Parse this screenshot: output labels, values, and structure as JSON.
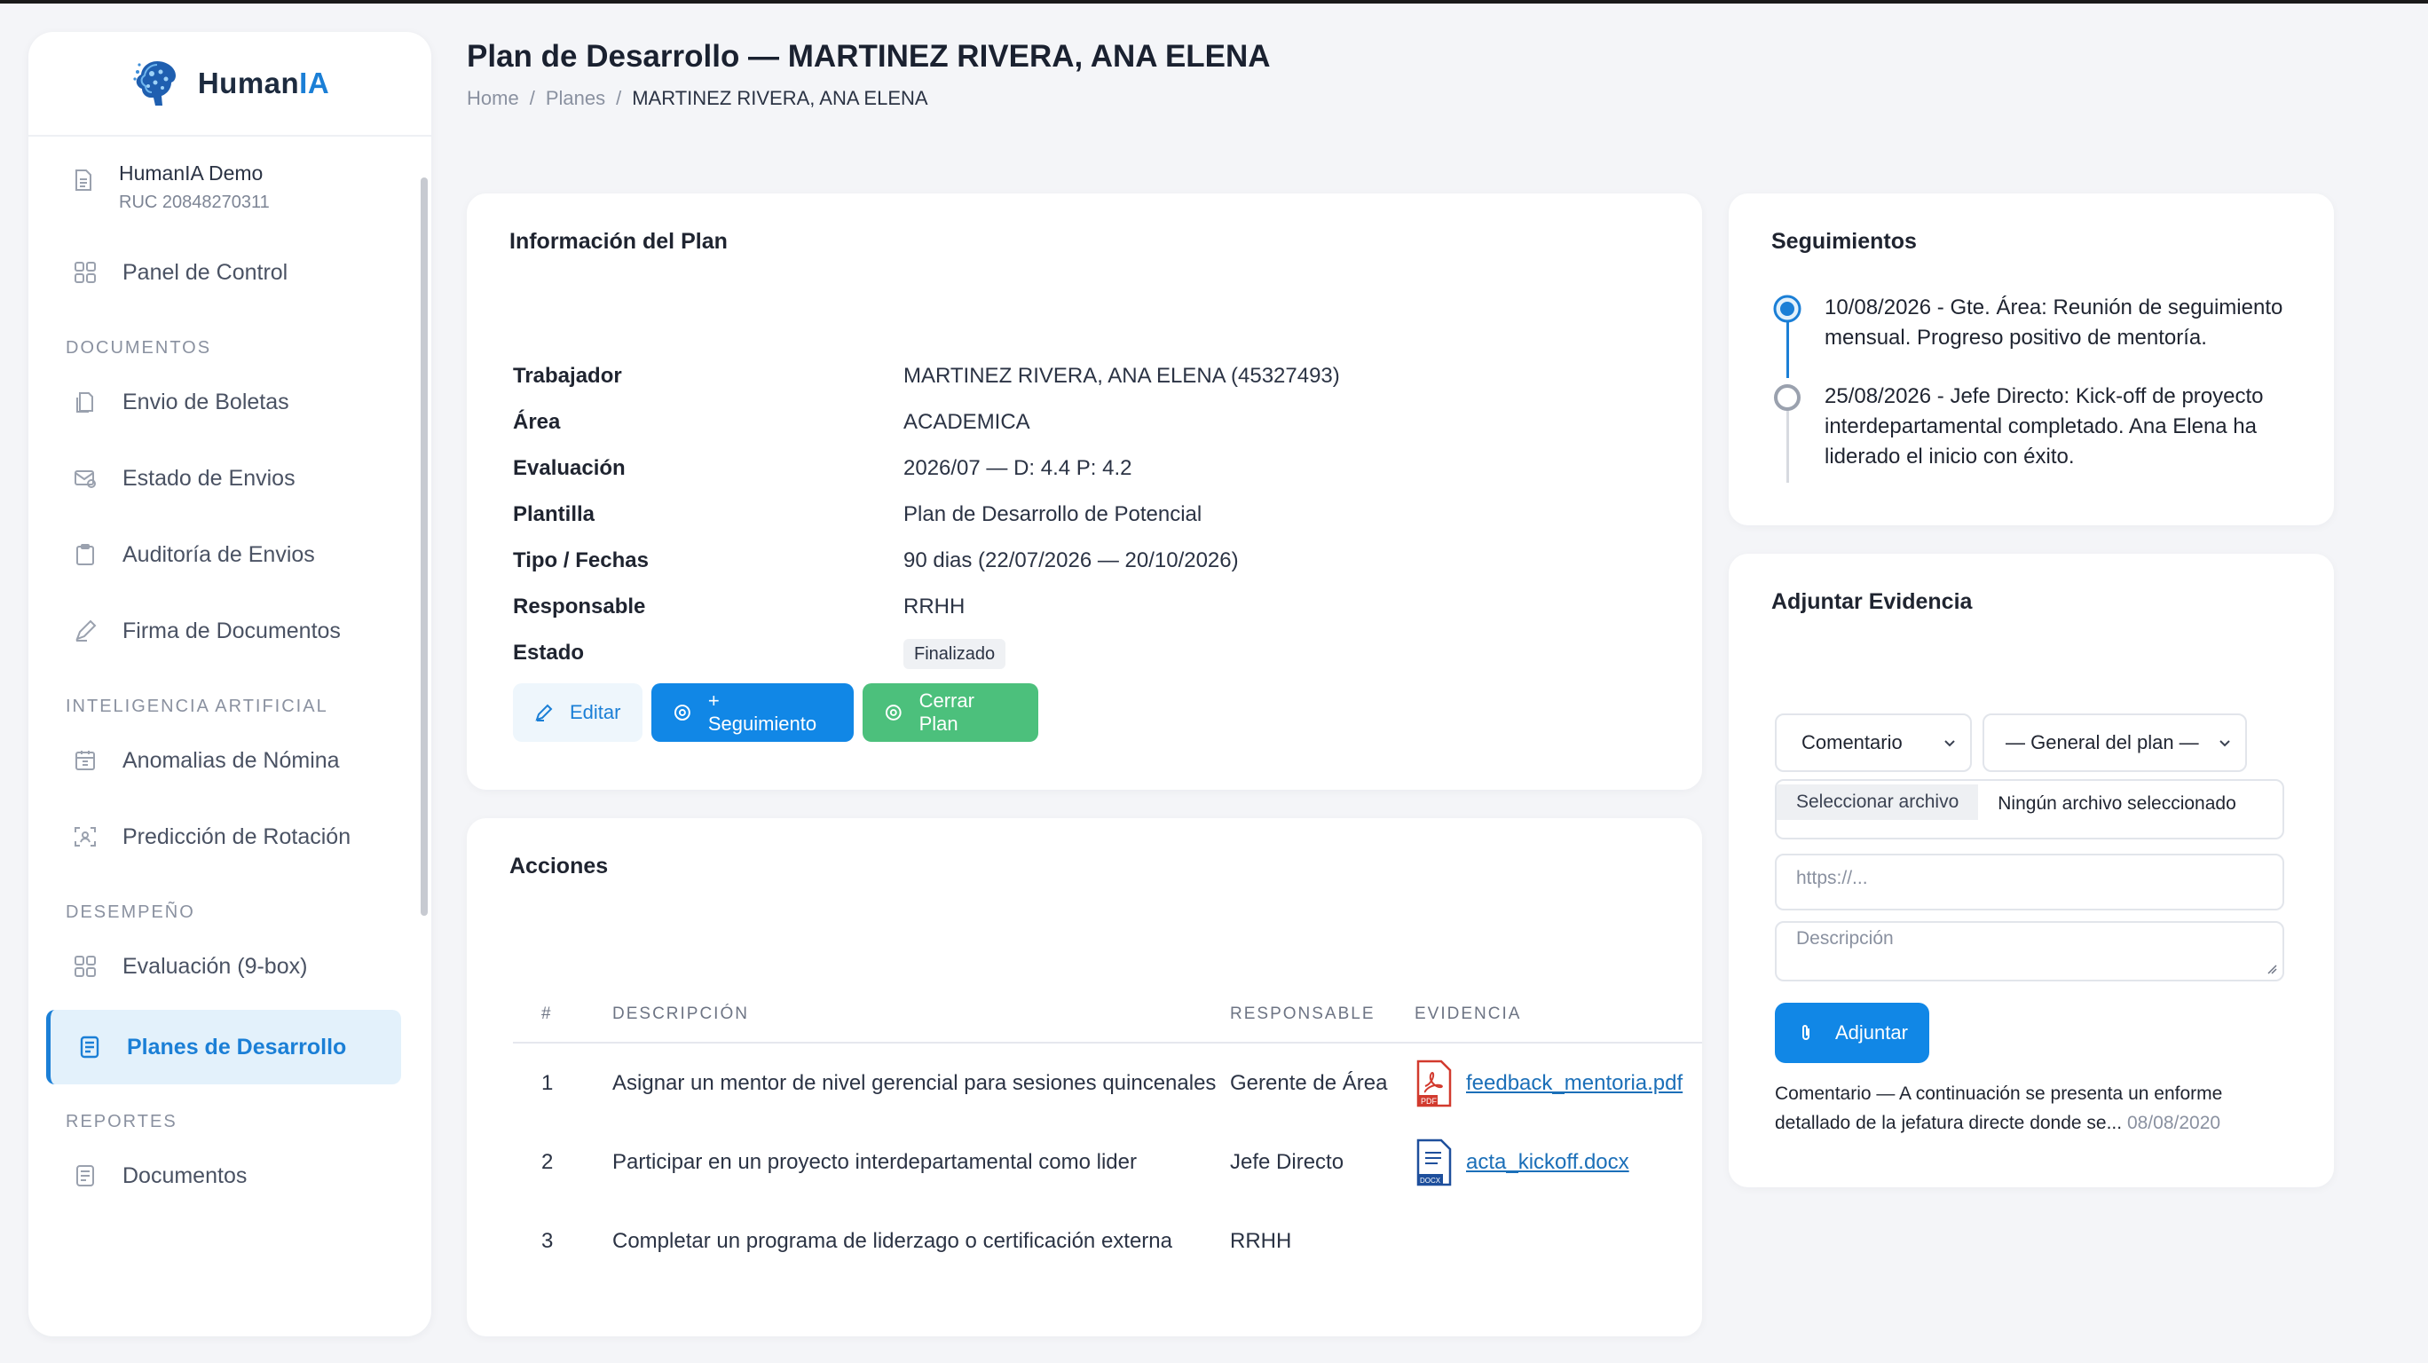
{
  "brand": {
    "name_main": "Human",
    "name_accent": "IA"
  },
  "company": {
    "name": "HumanIA Demo",
    "ruc": "RUC 20848270311"
  },
  "nav": {
    "panel": "Panel de Control",
    "section_documentos": "DOCUMENTOS",
    "envio_boletas": "Envio de Boletas",
    "estado_envios": "Estado de Envios",
    "auditoria_envios": "Auditoría de Envios",
    "firma_documentos": "Firma de Documentos",
    "section_ia": "INTELIGENCIA ARTIFICIAL",
    "anomalias": "Anomalias de Nómina",
    "prediccion": "Predicción de Rotación",
    "section_desempeno": "DESEMPEÑO",
    "evaluacion": "Evaluación (9-box)",
    "planes": "Planes de Desarrollo",
    "section_reportes": "REPORTES",
    "documentos": "Documentos"
  },
  "header": {
    "title": "Plan de Desarrollo — MARTINEZ RIVERA, ANA ELENA",
    "breadcrumb": [
      "Home",
      "/",
      "Planes",
      "/",
      "MARTINEZ RIVERA, ANA ELENA"
    ]
  },
  "info": {
    "title": "Información del Plan",
    "rows": [
      {
        "k": "Trabajador",
        "v": "MARTINEZ RIVERA, ANA ELENA (45327493)"
      },
      {
        "k": "Área",
        "v": "ACADEMICA"
      },
      {
        "k": "Evaluación",
        "v": "2026/07 — D: 4.4 P: 4.2"
      },
      {
        "k": "Plantilla",
        "v": "Plan de Desarrollo de Potencial"
      },
      {
        "k": "Tipo / Fechas",
        "v": "90 dias (22/07/2026 — 20/10/2026)"
      },
      {
        "k": "Responsable",
        "v": "RRHH"
      },
      {
        "k": "Estado",
        "v": "Finalizado"
      }
    ],
    "buttons": {
      "edit": "Editar",
      "seguimiento": "+ Seguimiento",
      "cerrar": "Cerrar Plan"
    }
  },
  "acciones": {
    "title": "Acciones",
    "headers": [
      "#",
      "DESCRIPCIÓN",
      "RESPONSABLE",
      "EVIDENCIA"
    ],
    "rows": [
      {
        "n": "1",
        "desc": "Asignar un mentor de nivel gerencial para sesiones quincenales",
        "resp": "Gerente de Área",
        "file": "feedback_mentoria.pdf",
        "file_type": "pdf"
      },
      {
        "n": "2",
        "desc": "Participar en un proyecto interdepartamental como lider",
        "resp": "Jefe Directo",
        "file": "acta_kickoff.docx",
        "file_type": "docx"
      },
      {
        "n": "3",
        "desc": "Completar un programa de liderzago o certificación externa",
        "resp": "RRHH",
        "file": "",
        "file_type": ""
      }
    ]
  },
  "seguimientos": {
    "title": "Seguimientos",
    "items": [
      {
        "text": "10/08/2026 - Gte. Área: Reunión de seguimiento mensual. Progreso positivo de mentoría.",
        "active": true
      },
      {
        "text": "25/08/2026 - Jefe Directo: Kick-off de proyecto interdepartamental completado. Ana Elena ha liderado el inicio con éxito.",
        "active": false
      }
    ]
  },
  "evidencia": {
    "title": "Adjuntar Evidencia",
    "tipo_selected": "Comentario",
    "accion_selected": "— General del plan —",
    "file_button": "Seleccionar archivo",
    "file_none": "Ningún archivo seleccionado",
    "url_placeholder": "https://...",
    "desc_placeholder": "Descripción",
    "submit": "Adjuntar",
    "note": "Comentario — A continuación se presenta un enforme detallado de la jefatura directe donde se...",
    "note_date": "08/08/2020"
  },
  "colors": {
    "accent": "#1187e6",
    "success": "#4cc07c",
    "active_bg": "#e3f1fb",
    "link": "#1b6fb8"
  }
}
